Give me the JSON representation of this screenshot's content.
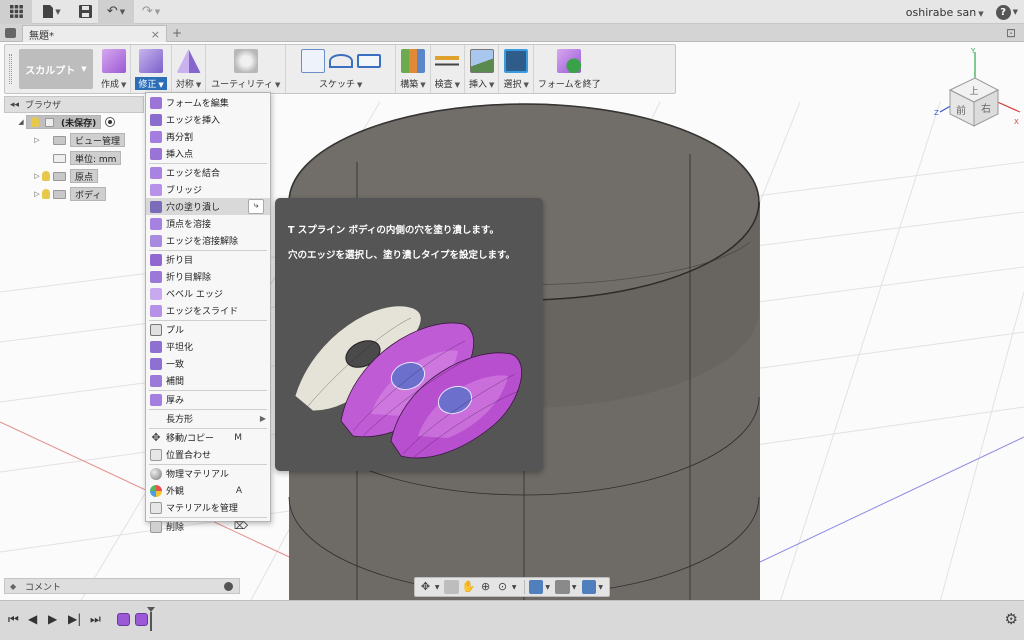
{
  "topbar": {
    "user": "oshirabe san",
    "help": "?"
  },
  "tab": {
    "title": "無題*",
    "close": "×",
    "add": "+"
  },
  "ribbon": {
    "workspace": "スカルプト",
    "groups": [
      {
        "id": "create",
        "label": "作成"
      },
      {
        "id": "modify",
        "label": "修正"
      },
      {
        "id": "symmetry",
        "label": "対称"
      },
      {
        "id": "utility",
        "label": "ユーティリティ"
      },
      {
        "id": "sketch",
        "label": "スケッチ"
      },
      {
        "id": "construct",
        "label": "構築"
      },
      {
        "id": "inspect",
        "label": "検査"
      },
      {
        "id": "insert",
        "label": "挿入"
      },
      {
        "id": "select",
        "label": "選択"
      },
      {
        "id": "finish",
        "label": "フォームを終了"
      }
    ]
  },
  "browser": {
    "title": "ブラウザ",
    "root": "(未保存)",
    "items": [
      "ビュー管理",
      "単位: mm",
      "原点",
      "ボディ"
    ]
  },
  "menu": {
    "items": [
      "フォームを編集",
      "エッジを挿入",
      "再分割",
      "挿入点",
      "エッジを結合",
      "ブリッジ",
      "穴の塗り潰し",
      "頂点を溶接",
      "エッジを溶接解除",
      "折り目",
      "折り目解除",
      "ベベル エッジ",
      "エッジをスライド",
      "プル",
      "平坦化",
      "一致",
      "補間",
      "厚み",
      "長方形",
      "移動/コピー",
      "位置合わせ",
      "物理マテリアル",
      "外観",
      "マテリアルを管理",
      "削除"
    ],
    "shortcuts": {
      "move": "M",
      "appearance": "A"
    }
  },
  "tooltip": {
    "line1": "T スプライン ボディの内側の穴を塗り潰します。",
    "line2": "穴のエッジを選択し、塗り潰しタイプを設定します。"
  },
  "viewcube": {
    "top": "上",
    "front": "前",
    "right": "右",
    "axes": {
      "x": "X",
      "y": "Y",
      "z": "Z"
    }
  },
  "comment": {
    "label": "コメント"
  },
  "colors": {
    "accent": "#2c6fb7",
    "tspline_purple": "#b44ec8",
    "cylinder": "#6e6a66"
  }
}
